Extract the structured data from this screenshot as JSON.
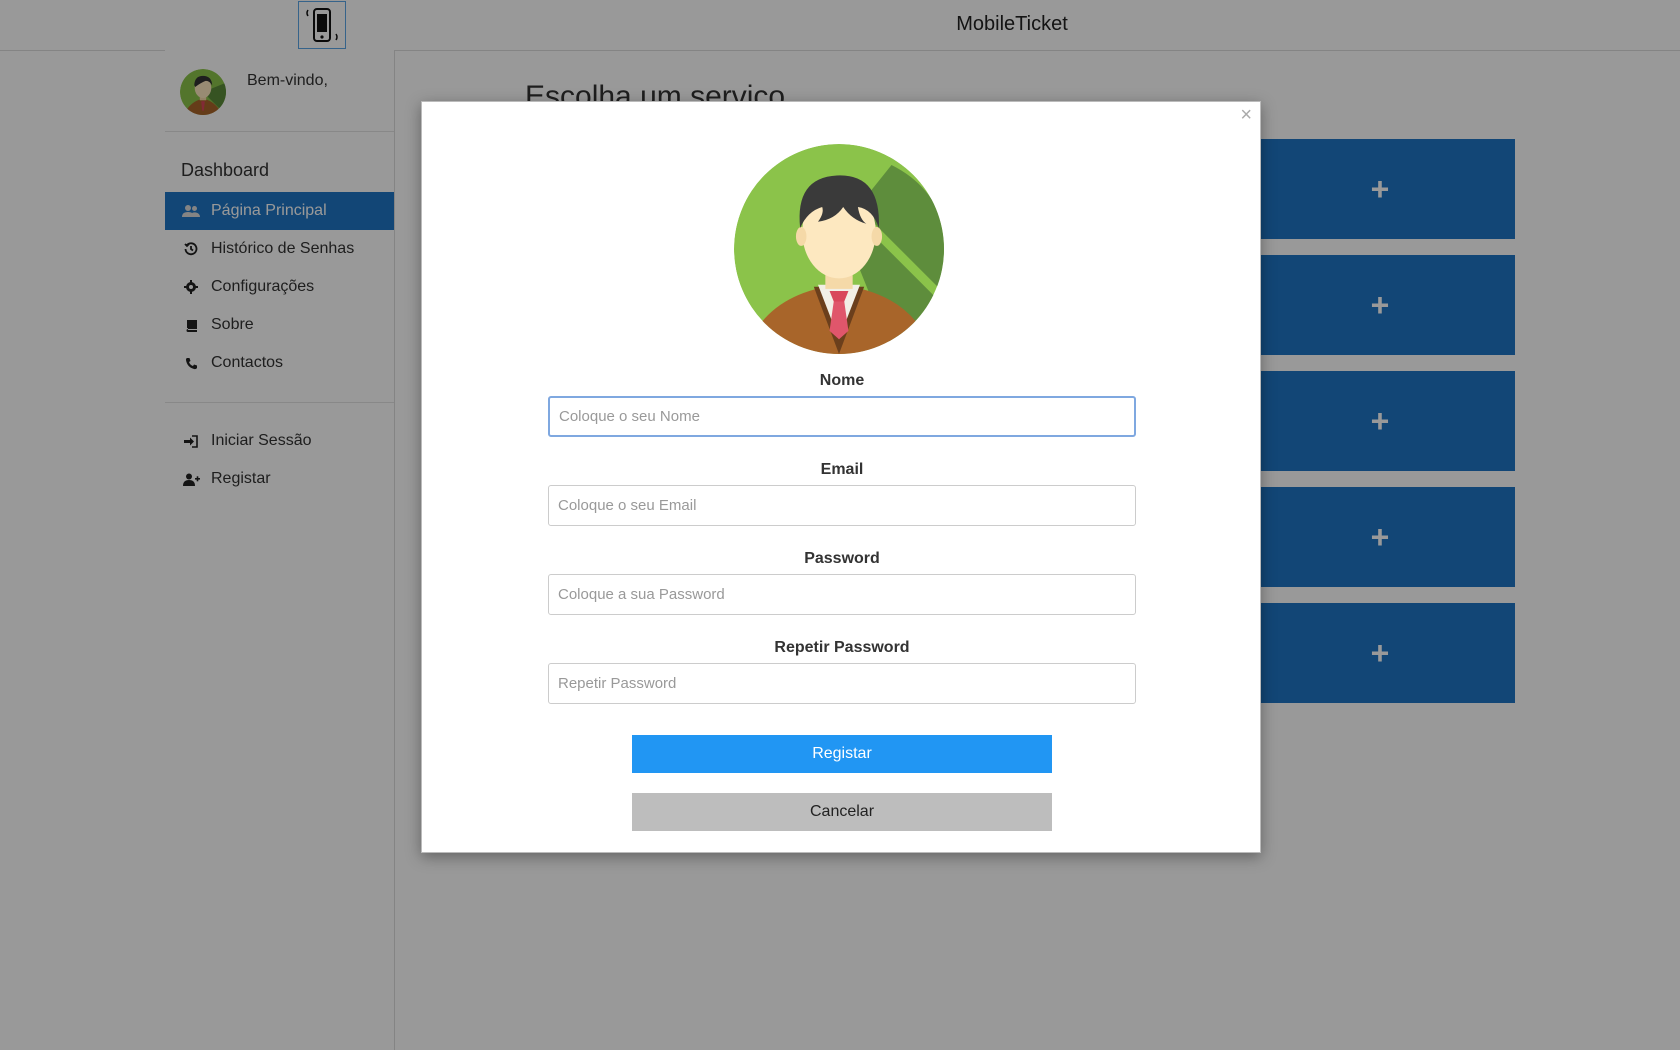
{
  "header": {
    "app_title": "MobileTicket",
    "logo_icon": "phone-ticket-icon"
  },
  "sidebar": {
    "welcome_text": "Bem-vindo,",
    "dashboard_title": "Dashboard",
    "items": [
      {
        "label": "Página Principal",
        "icon": "users-icon",
        "active": true
      },
      {
        "label": "Histórico de Senhas",
        "icon": "history-icon"
      },
      {
        "label": "Configurações",
        "icon": "gear-icon"
      },
      {
        "label": "Sobre",
        "icon": "book-icon"
      },
      {
        "label": "Contactos",
        "icon": "phone-icon"
      }
    ],
    "account_items": [
      {
        "label": "Iniciar Sessão",
        "icon": "login-icon"
      },
      {
        "label": "Registar",
        "icon": "add-user-icon"
      }
    ]
  },
  "main": {
    "title": "Escolha um serviço",
    "service_buttons": [
      "+",
      "+",
      "+",
      "+",
      "+"
    ]
  },
  "modal": {
    "close_label": "×",
    "fields": [
      {
        "label": "Nome",
        "placeholder": "Coloque o seu Nome"
      },
      {
        "label": "Email",
        "placeholder": "Coloque o seu Email"
      },
      {
        "label": "Password",
        "placeholder": "Coloque a sua Password"
      },
      {
        "label": "Repetir Password",
        "placeholder": "Repetir Password"
      }
    ],
    "submit_label": "Registar",
    "cancel_label": "Cancelar"
  },
  "colors": {
    "accent": "#1f76c5",
    "primary_button": "#2196f3",
    "cancel_button": "#bdbdbd"
  }
}
